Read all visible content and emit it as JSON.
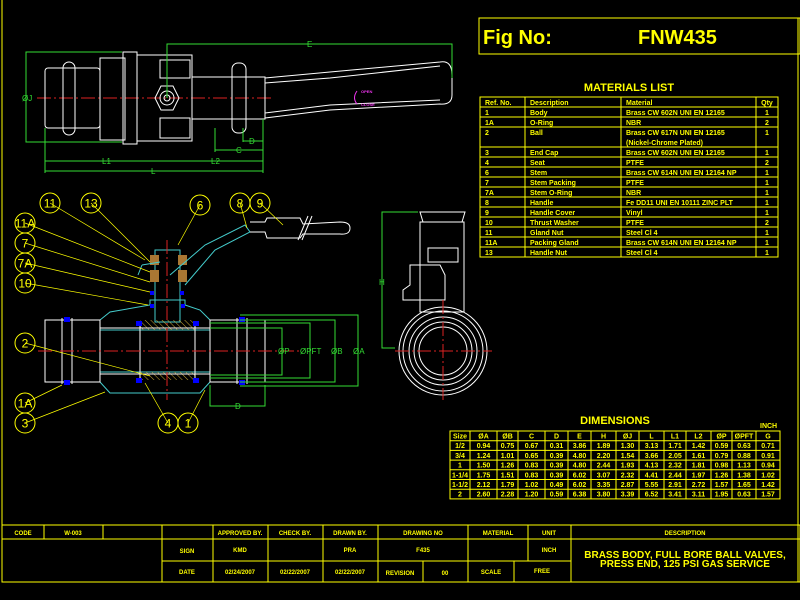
{
  "header": {
    "fig_label": "Fig  No:",
    "fig_number": "FNW435"
  },
  "materials": {
    "title": "MATERIALS LIST",
    "columns": [
      "Ref. No.",
      "Description",
      "Material",
      "Qty"
    ],
    "rows": [
      [
        "1",
        "Body",
        "Brass CW 602N UNI EN 12165",
        "1"
      ],
      [
        "1A",
        "O-Ring",
        "NBR",
        "2"
      ],
      [
        "2",
        "Ball",
        "Brass CW 617N UNI EN 12165",
        "1"
      ],
      [
        "",
        "",
        "(Nickel-Chrome Plated)",
        ""
      ],
      [
        "3",
        "End Cap",
        "Brass CW 602N UNI EN 12165",
        "1"
      ],
      [
        "4",
        "Seat",
        "PTFE",
        "2"
      ],
      [
        "6",
        "Stem",
        "Brass CW 614N UNI EN 12164 NP",
        "1"
      ],
      [
        "7",
        "Stem Packing",
        "PTFE",
        "1"
      ],
      [
        "7A",
        "Stem O-Ring",
        "NBR",
        "1"
      ],
      [
        "8",
        "Handle",
        "Fe DD11 UNI EN 10111  ZINC PLT",
        "1"
      ],
      [
        "9",
        "Handle Cover",
        "Vinyl",
        "1"
      ],
      [
        "10",
        "Thrust Washer",
        "PTFE",
        "2"
      ],
      [
        "11",
        "Gland Nut",
        "Steel  Cl 4",
        "1"
      ],
      [
        "11A",
        "Packing Gland",
        "Brass CW 614N UNI EN 12164 NP",
        "1"
      ],
      [
        "13",
        "Handle Nut",
        "Steel  Cl 4",
        "1"
      ]
    ]
  },
  "dimensions": {
    "title": "DIMENSIONS",
    "unit": "INCH",
    "columns": [
      "Size",
      "ØA",
      "ØB",
      "C",
      "D",
      "E",
      "H",
      "ØJ",
      "L",
      "L1",
      "L2",
      "ØP",
      "ØPFT",
      "G"
    ],
    "rows": [
      [
        "1/2",
        "0.94",
        "0.75",
        "0.67",
        "0.31",
        "3.86",
        "1.89",
        "1.30",
        "3.13",
        "1.71",
        "1.42",
        "0.59",
        "0.63",
        "0.71"
      ],
      [
        "3/4",
        "1.24",
        "1.01",
        "0.65",
        "0.39",
        "4.80",
        "2.20",
        "1.54",
        "3.66",
        "2.05",
        "1.61",
        "0.79",
        "0.88",
        "0.91"
      ],
      [
        "1",
        "1.50",
        "1.26",
        "0.83",
        "0.39",
        "4.80",
        "2.44",
        "1.93",
        "4.13",
        "2.32",
        "1.81",
        "0.98",
        "1.13",
        "0.94"
      ],
      [
        "1-1/4",
        "1.75",
        "1.51",
        "0.83",
        "0.39",
        "6.02",
        "3.07",
        "2.32",
        "4.41",
        "2.44",
        "1.97",
        "1.26",
        "1.38",
        "1.02"
      ],
      [
        "1-1/2",
        "2.12",
        "1.79",
        "1.02",
        "0.49",
        "6.02",
        "3.35",
        "2.87",
        "5.55",
        "2.91",
        "2.72",
        "1.57",
        "1.65",
        "1.42"
      ],
      [
        "2",
        "2.60",
        "2.28",
        "1.20",
        "0.59",
        "6.38",
        "3.80",
        "3.39",
        "6.52",
        "3.41",
        "3.11",
        "1.95",
        "0.63",
        "1.57"
      ]
    ]
  },
  "drawing": {
    "top_view_labels": {
      "E": "E",
      "J": "ØJ",
      "L1": "L1",
      "L2": "L2",
      "L": "L",
      "C": "C",
      "D": "D",
      "open": "OPEN",
      "close": "CLOSE"
    },
    "section_labels": {
      "P": "ØP",
      "PFT": "ØPFT",
      "B": "ØB",
      "A": "ØA",
      "D": "D"
    },
    "side_labels": {
      "H": "H"
    },
    "balloons": [
      "11",
      "13",
      "6",
      "8",
      "9",
      "11A",
      "7",
      "7A",
      "10",
      "2",
      "1A",
      "3",
      "4",
      "1"
    ],
    "colors": {
      "frame": "#ffff00",
      "dimension": "#33dd33",
      "centerline": "#dd2222",
      "outline": "#ffffff",
      "section": "#44cccc",
      "seal": "#0000ff"
    }
  },
  "title_block": {
    "code_label": "CODE",
    "code_value": "W-003",
    "approved_label": "APPROVED BY.",
    "check_label": "CHECK BY.",
    "drawn_label": "DRAWN BY.",
    "drawing_no_label": "DRAWING NO",
    "material_label": "MATERIAL",
    "unit_label": "UNIT",
    "description_label": "DESCRIPTION",
    "sign_label": "SIGN",
    "approved_sign": "KMD",
    "drawn_sign": "PRA",
    "drawing_no": "F435",
    "unit_value": "INCH",
    "date_label": "DATE",
    "approved_date": "02/24/2007",
    "check_date": "02/22/2007",
    "drawn_date": "02/22/2007",
    "revision_label": "REVISION",
    "revision_value": "00",
    "scale_label": "SCALE",
    "scale_value": "FREE",
    "description_line1": "BRASS BODY, FULL BORE BALL VALVES,",
    "description_line2": "PRESS END, 125 PSI GAS SERVICE"
  }
}
